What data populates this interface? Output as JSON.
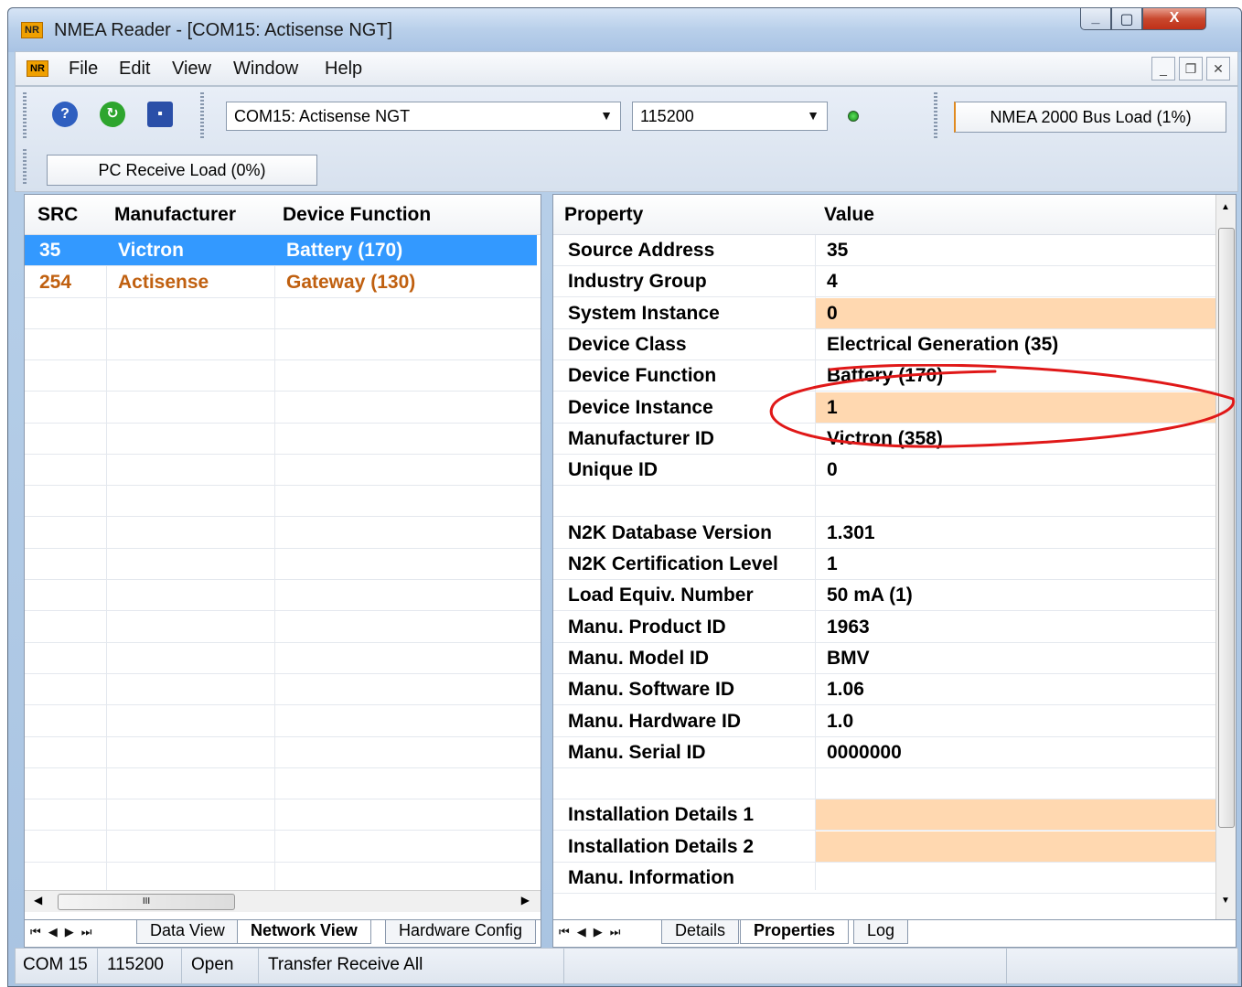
{
  "window": {
    "icon_text": "NR",
    "title": "NMEA Reader - [COM15: Actisense NGT]",
    "controls": {
      "minimize": "_",
      "maximize": "▢",
      "close": "X"
    }
  },
  "menu": {
    "icon_text": "NR",
    "items": [
      "File",
      "Edit",
      "View",
      "Window",
      "Help"
    ],
    "mdi": {
      "minimize": "_",
      "restore": "❐",
      "close": "✕"
    }
  },
  "toolbar": {
    "port_combo": "COM15: Actisense NGT",
    "baud_combo": "115200",
    "bus_load": "NMEA 2000 Bus Load (1%)",
    "pc_receive_load": "PC Receive Load (0%)",
    "colors": {
      "help": "#2f5fc0",
      "refresh": "#2ea52e",
      "save": "#2a4fa8",
      "led": "#22aa22"
    }
  },
  "device_list": {
    "columns": [
      "SRC",
      "Manufacturer",
      "Device Function"
    ],
    "rows": [
      {
        "src": "35",
        "manufacturer": "Victron",
        "function": "Battery (170)",
        "selected": true
      },
      {
        "src": "254",
        "manufacturer": "Actisense",
        "function": "Gateway (130)",
        "selected": false
      }
    ],
    "tabs": [
      "Data View",
      "Network View",
      "Hardware Config"
    ],
    "active_tab": "Network View",
    "scroll_grip": "III"
  },
  "properties": {
    "columns": [
      "Property",
      "Value"
    ],
    "rows": [
      {
        "property": "Source Address",
        "value": "35"
      },
      {
        "property": "Industry Group",
        "value": "4"
      },
      {
        "property": "System Instance",
        "value": "0",
        "highlight": true
      },
      {
        "property": "Device Class",
        "value": "Electrical Generation (35)"
      },
      {
        "property": "Device Function",
        "value": "Battery (170)"
      },
      {
        "property": "Device Instance",
        "value": "1",
        "highlight": true
      },
      {
        "property": "Manufacturer ID",
        "value": "Victron (358)"
      },
      {
        "property": "Unique ID",
        "value": "0"
      },
      {
        "property": "",
        "value": ""
      },
      {
        "property": "N2K Database Version",
        "value": "1.301"
      },
      {
        "property": "N2K Certification Level",
        "value": "1"
      },
      {
        "property": "Load Equiv. Number",
        "value": "50 mA (1)"
      },
      {
        "property": "Manu. Product ID",
        "value": "1963"
      },
      {
        "property": "Manu. Model ID",
        "value": "BMV"
      },
      {
        "property": "Manu. Software ID",
        "value": "1.06"
      },
      {
        "property": "Manu. Hardware ID",
        "value": "1.0"
      },
      {
        "property": "Manu. Serial ID",
        "value": "0000000"
      },
      {
        "property": "",
        "value": ""
      },
      {
        "property": "Installation Details 1",
        "value": "",
        "highlight": true
      },
      {
        "property": "Installation Details 2",
        "value": "",
        "highlight": true
      },
      {
        "property": "Manu. Information",
        "value": ""
      }
    ],
    "tabs": [
      "Details",
      "Properties",
      "Log"
    ],
    "active_tab": "Properties",
    "highlight_color": "#ffd8b0",
    "annotation_color": "#e01818"
  },
  "status": {
    "port": "COM 15",
    "baud": "115200",
    "state": "Open",
    "mode": "Transfer Receive All"
  }
}
